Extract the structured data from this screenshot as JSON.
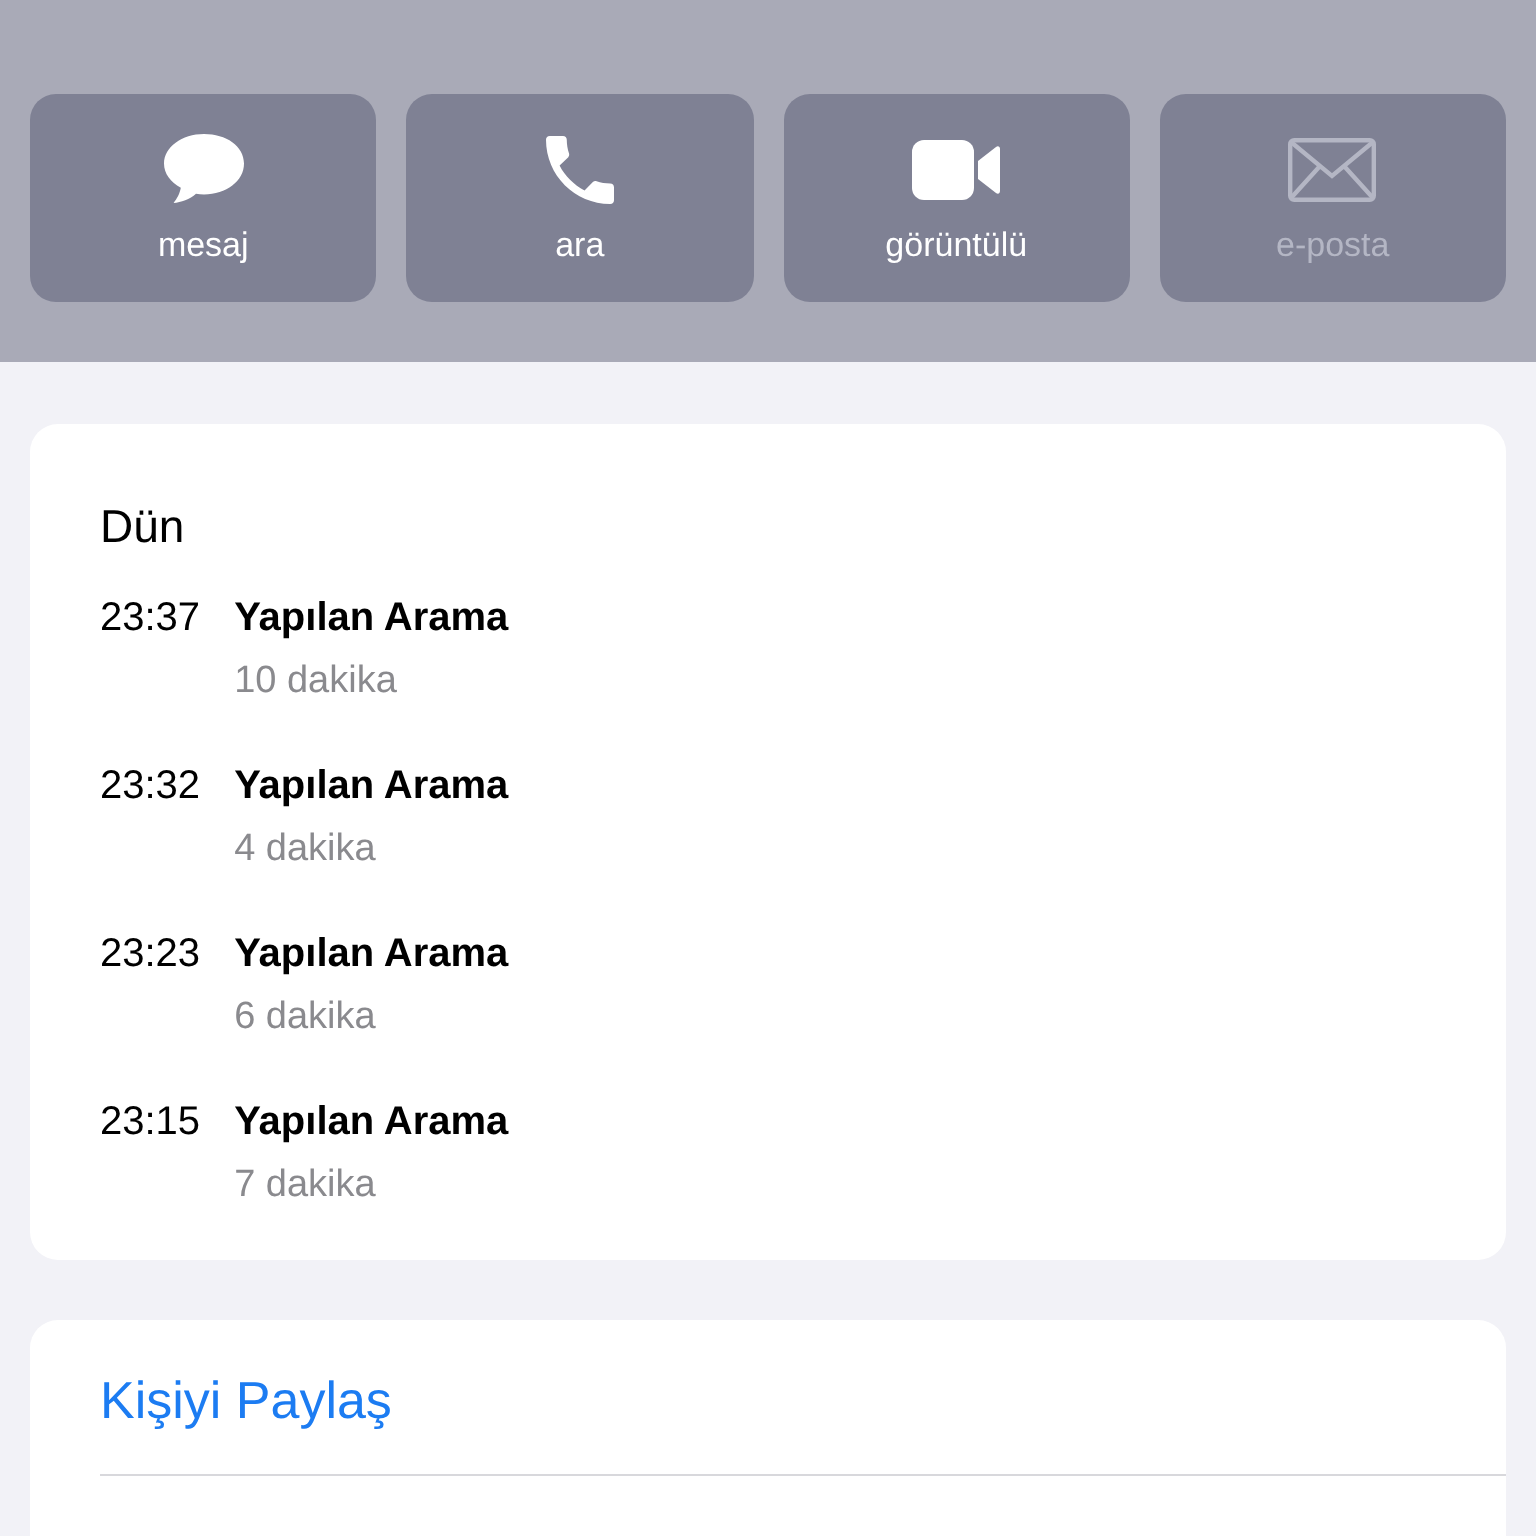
{
  "actions": [
    {
      "kind": "message",
      "label": "mesaj",
      "disabled": false
    },
    {
      "kind": "call",
      "label": "ara",
      "disabled": false
    },
    {
      "kind": "video",
      "label": "görüntülü",
      "disabled": false
    },
    {
      "kind": "mail",
      "label": "e-posta",
      "disabled": true
    }
  ],
  "call_history": {
    "heading": "Dün",
    "calls": [
      {
        "time": "23:37",
        "type": "Yapılan Arama",
        "duration": "10 dakika"
      },
      {
        "time": "23:32",
        "type": "Yapılan Arama",
        "duration": "4 dakika"
      },
      {
        "time": "23:23",
        "type": "Yapılan Arama",
        "duration": "6 dakika"
      },
      {
        "time": "23:15",
        "type": "Yapılan Arama",
        "duration": "7 dakika"
      }
    ]
  },
  "share_contact": {
    "label": "Kişiyi Paylaş"
  }
}
